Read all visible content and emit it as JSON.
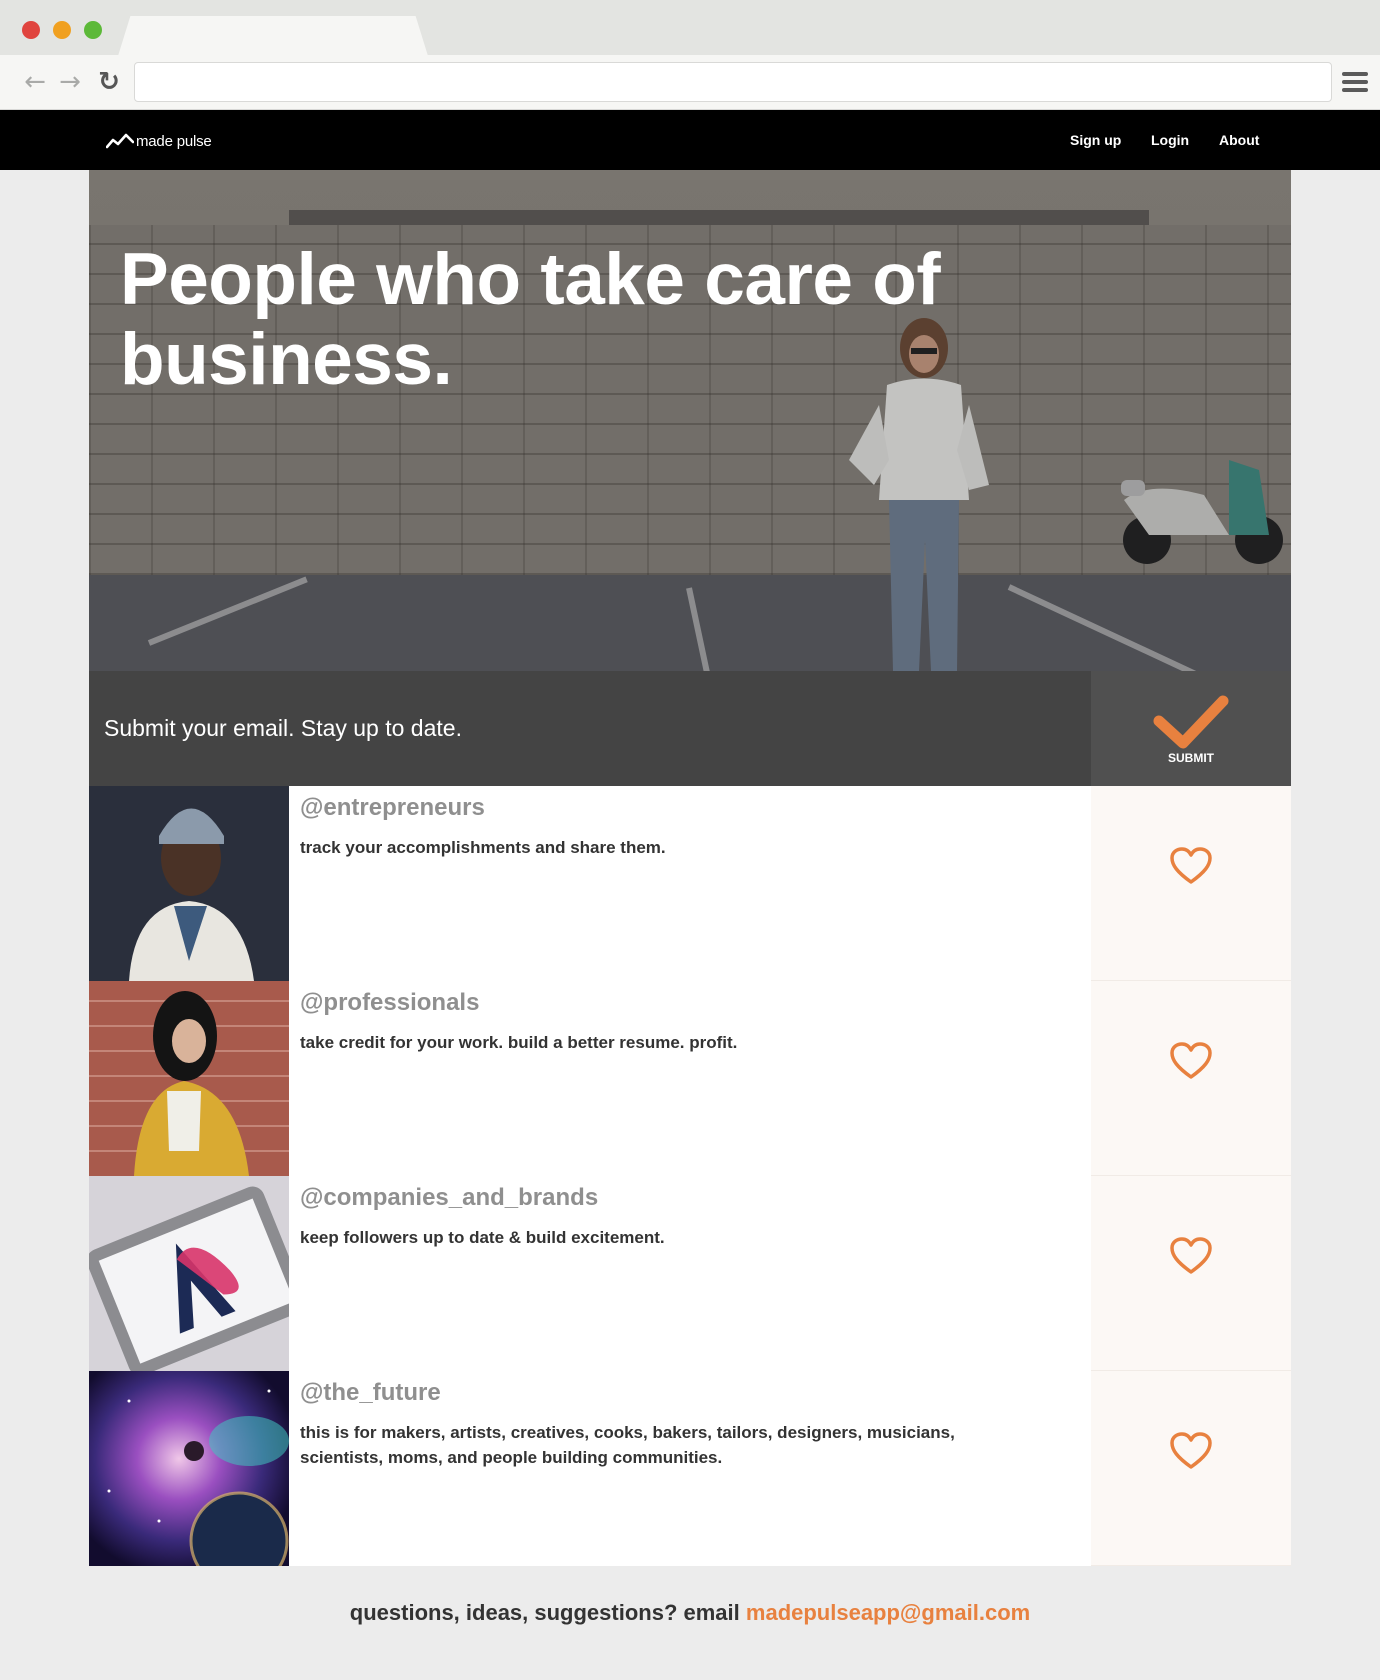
{
  "browser": {
    "address": "",
    "icons": [
      "back-arrow-icon",
      "forward-arrow-icon",
      "reload-icon",
      "hamburger-menu-icon"
    ]
  },
  "header": {
    "logo_text": "made pulse",
    "nav": [
      {
        "label": "Sign up"
      },
      {
        "label": "Login"
      },
      {
        "label": "About"
      }
    ]
  },
  "hero": {
    "title": "People who take care of business."
  },
  "subscribe": {
    "prompt": "Submit your email. Stay up to date.",
    "submit_label": "SUBMIT",
    "icon": "checkmark-icon"
  },
  "audiences": [
    {
      "handle": "@entrepreneurs",
      "description": "track your accomplishments and share them.",
      "icon": "heart-icon"
    },
    {
      "handle": "@professionals",
      "description": "take credit for your work. build a better resume. profit.",
      "icon": "heart-icon"
    },
    {
      "handle": "@companies_and_brands",
      "description": "keep followers up to date & build excitement.",
      "icon": "heart-icon"
    },
    {
      "handle": "@the_future",
      "description": "this is for makers, artists, creatives, cooks, bakers, tailors, designers, musicians, scientists, moms, and people building communities.",
      "icon": "heart-icon"
    }
  ],
  "footer": {
    "prefix": "questions, ideas, suggestions? email ",
    "email": "madepulseapp@gmail.com"
  },
  "colors": {
    "accent": "#e8813f",
    "header_bg": "#000000",
    "subscribe_bg": "#444444",
    "like_bg": "#fcf8f5"
  }
}
